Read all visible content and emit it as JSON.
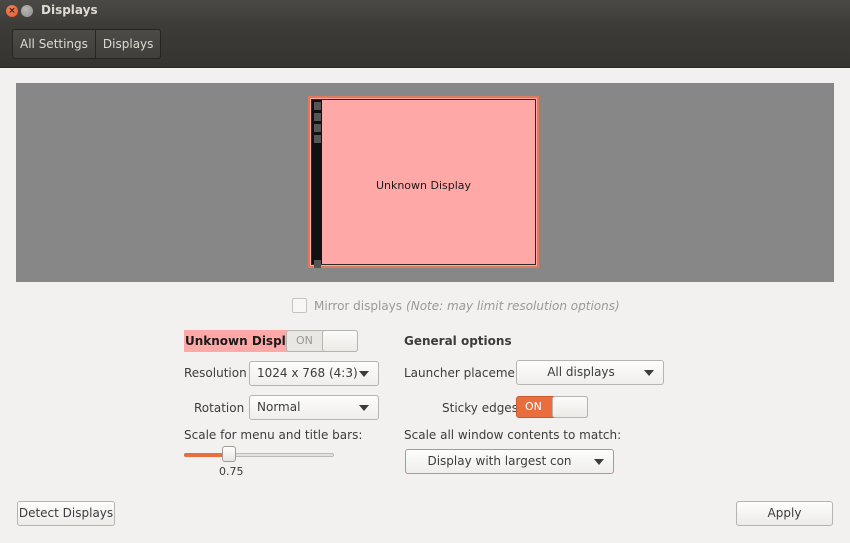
{
  "window": {
    "title": "Displays",
    "close_glyph": "×"
  },
  "breadcrumb": {
    "items": [
      "All Settings",
      "Displays"
    ]
  },
  "preview": {
    "monitor_label": "Unknown Display",
    "monitor_color": "#ffa8a8",
    "background_color": "#878787"
  },
  "mirror": {
    "label": "Mirror displays",
    "note": "(Note: may limit resolution options)",
    "checked": false
  },
  "display": {
    "name": "Unknown Display",
    "power_switch": {
      "label": "ON",
      "state": "off"
    },
    "resolution_label": "Resolution",
    "resolution_value": "1024 x 768 (4:3)",
    "rotation_label": "Rotation",
    "rotation_value": "Normal",
    "scale_label": "Scale for menu and title bars:",
    "scale_value": "0.75",
    "scale_fraction": 0.3
  },
  "general": {
    "heading": "General options",
    "launcher_label": "Launcher placement",
    "launcher_value": "All displays",
    "sticky_label": "Sticky edges",
    "sticky_switch": {
      "label": "ON",
      "state": "on"
    },
    "scale_all_label": "Scale all window contents to match:",
    "scale_all_value": "Display with largest con"
  },
  "buttons": {
    "detect": "Detect Displays",
    "apply": "Apply"
  },
  "colors": {
    "accent": "#e96e3f",
    "highlight": "#ffa8a8"
  }
}
